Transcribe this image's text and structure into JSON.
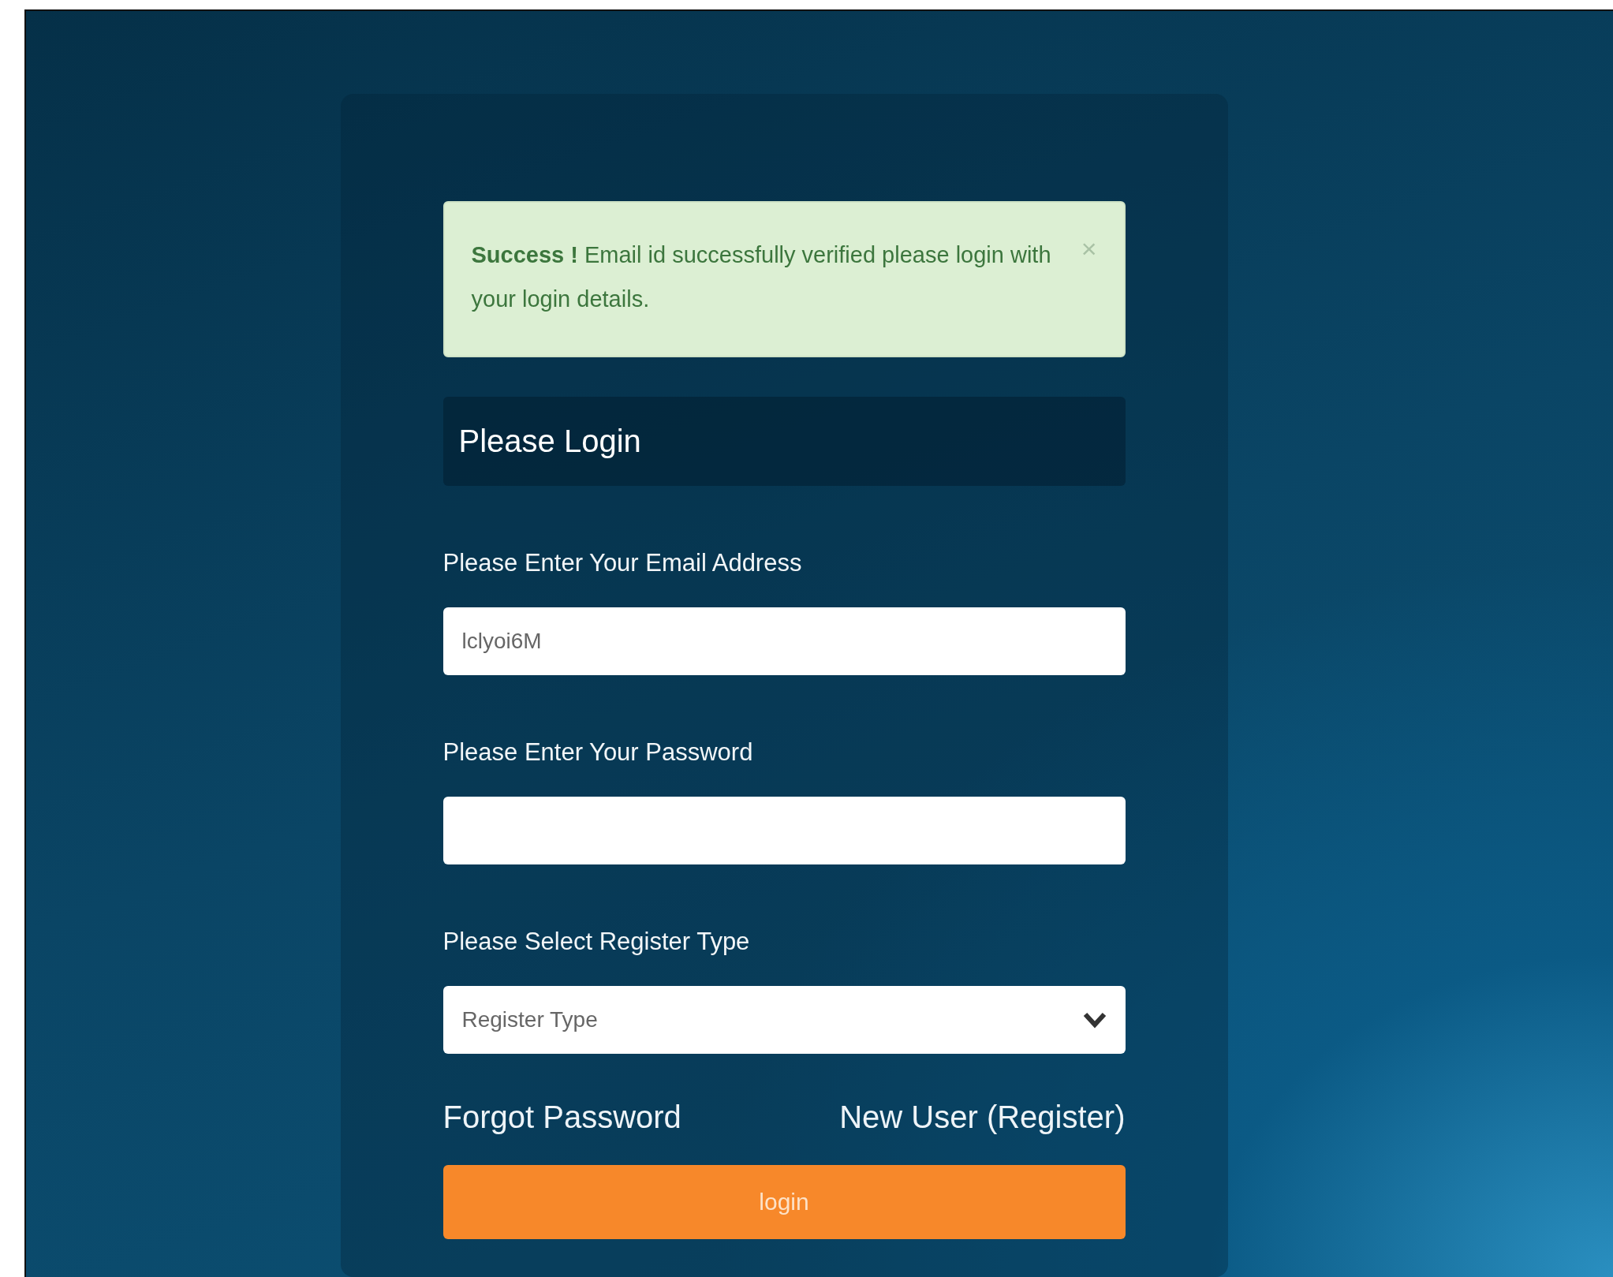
{
  "alert": {
    "title": "Success !",
    "message": "Email id successfully verified please login with your login details.",
    "close": "×"
  },
  "heading": "Please Login",
  "fields": [
    {
      "kind": "text",
      "label": "Please Enter Your Email Address",
      "value": "lclyoi6M"
    },
    {
      "kind": "password",
      "label": "Please Enter Your Password"
    },
    {
      "kind": "select",
      "label": "Please Select Register Type",
      "value": "Register Type"
    }
  ],
  "links": [
    "Forgot Password",
    "New User (Register)"
  ],
  "button": "login"
}
